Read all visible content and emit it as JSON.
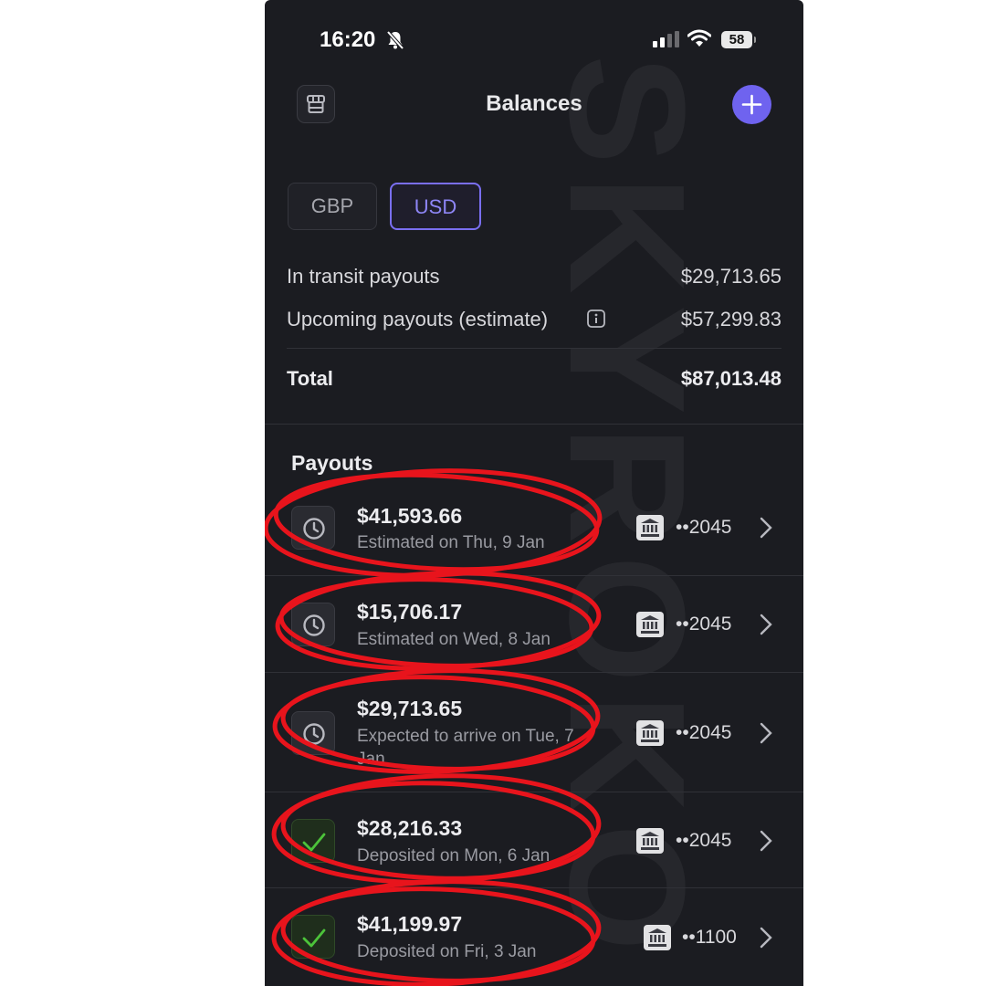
{
  "status_bar": {
    "time": "16:20",
    "battery": "58",
    "icons": [
      "bell-slash-icon",
      "signal-icon",
      "wifi-icon",
      "battery-icon"
    ]
  },
  "header": {
    "title": "Balances",
    "left_icon": "store-icon",
    "right_icon": "plus-icon"
  },
  "currency_tabs": [
    {
      "label": "GBP",
      "selected": false
    },
    {
      "label": "USD",
      "selected": true
    }
  ],
  "summary": {
    "in_transit_label": "In transit payouts",
    "in_transit_value": "$29,713.65",
    "upcoming_label": "Upcoming payouts (estimate)",
    "upcoming_value": "$57,299.83",
    "total_label": "Total",
    "total_value": "$87,013.48"
  },
  "payouts": {
    "title": "Payouts",
    "items": [
      {
        "amount": "$41,593.66",
        "status_text": "Estimated on Thu, 9 Jan",
        "status": "pending",
        "account": "••2045"
      },
      {
        "amount": "$15,706.17",
        "status_text": "Estimated on Wed, 8 Jan",
        "status": "pending",
        "account": "••2045"
      },
      {
        "amount": "$29,713.65",
        "status_text": "Expected to arrive on Tue, 7 Jan",
        "status": "pending",
        "account": "••2045"
      },
      {
        "amount": "$28,216.33",
        "status_text": "Deposited on Mon, 6 Jan",
        "status": "deposited",
        "account": "••2045"
      },
      {
        "amount": "$41,199.97",
        "status_text": "Deposited on Fri, 3 Jan",
        "status": "deposited",
        "account": "••1100"
      }
    ]
  },
  "watermark": "SKYROKO",
  "colors": {
    "background": "#1b1c21",
    "accent": "#6f63ef",
    "success": "#4cc33a",
    "annotation": "#e8141c"
  }
}
